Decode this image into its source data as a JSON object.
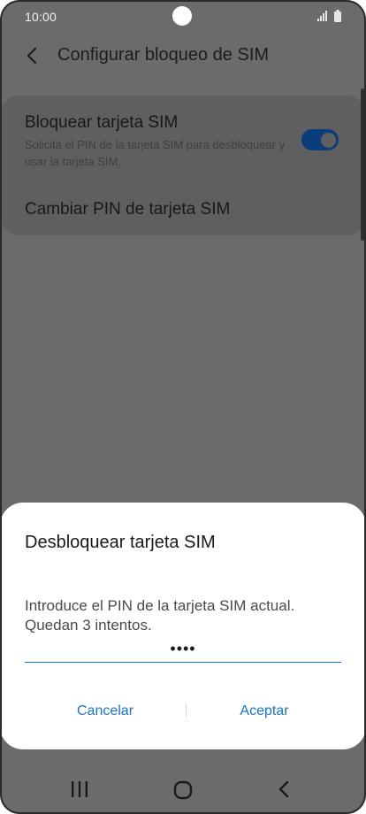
{
  "status_bar": {
    "time": "10:00"
  },
  "header": {
    "title": "Configurar bloqueo de SIM"
  },
  "settings": {
    "lock_sim": {
      "title": "Bloquear tarjeta SIM",
      "summary": "Solicita el PIN de la tarjeta SIM para desbloquear y usar la tarjeta SIM.",
      "enabled": true
    },
    "change_pin": {
      "title": "Cambiar PIN de tarjeta SIM"
    }
  },
  "dialog": {
    "title": "Desbloquear tarjeta SIM",
    "message": "Introduce el PIN de la tarjeta SIM actual. Quedan 3 intentos.",
    "pin_value": "••••",
    "cancel_label": "Cancelar",
    "ok_label": "Aceptar"
  },
  "nav_bar": {
    "icons": [
      "recent-apps-icon",
      "home-icon",
      "back-icon"
    ]
  },
  "colors": {
    "accent": "#1a73c5",
    "scrim": "#6b6b6b",
    "toggle_on": "#0a3d7a"
  }
}
